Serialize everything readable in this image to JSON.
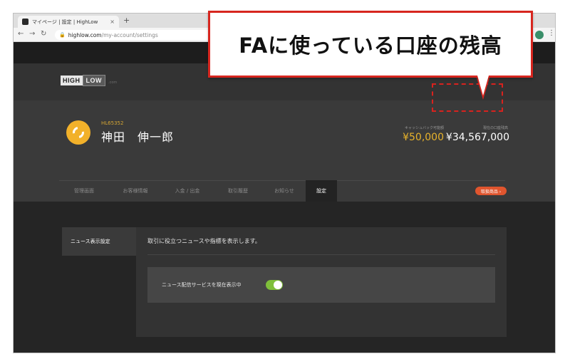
{
  "browser": {
    "tab_title": "マイページ | 設定 | HighLow",
    "tab_close": "×",
    "new_tab": "+",
    "url_host": "highlow.com",
    "url_path": "/my-account/settings"
  },
  "site": {
    "logo_high": "HIGH",
    "logo_low": "LOW",
    "logo_com": ".com",
    "user": {
      "id": "HL65352",
      "name": "神田　伸一郎"
    },
    "cashback": {
      "label": "キャッシュバック可能額",
      "value": "¥50,000"
    },
    "balance": {
      "label": "現在の口座残高",
      "value": "¥34,567,000"
    },
    "nav": [
      {
        "label": "管理画面"
      },
      {
        "label": "お客様情報"
      },
      {
        "label": "入金 / 出金"
      },
      {
        "label": "取引履歴"
      },
      {
        "label": "お知らせ"
      },
      {
        "label": "設定"
      }
    ],
    "cta_label": "取扱商品 ›",
    "settings": {
      "side_item": "ニュース表示設定",
      "description": "取引に役立つニュースや指標を表示します。",
      "row_label": "ニュース配信サービスを現在表示中",
      "toggle_on": true
    }
  },
  "callout": {
    "text": "FAに使っている口座の残高"
  },
  "colors": {
    "accent_gold": "#e8b32b",
    "callout_red": "#d7261f",
    "cta_orange": "#e0552e",
    "toggle_green": "#7fbf3a"
  }
}
